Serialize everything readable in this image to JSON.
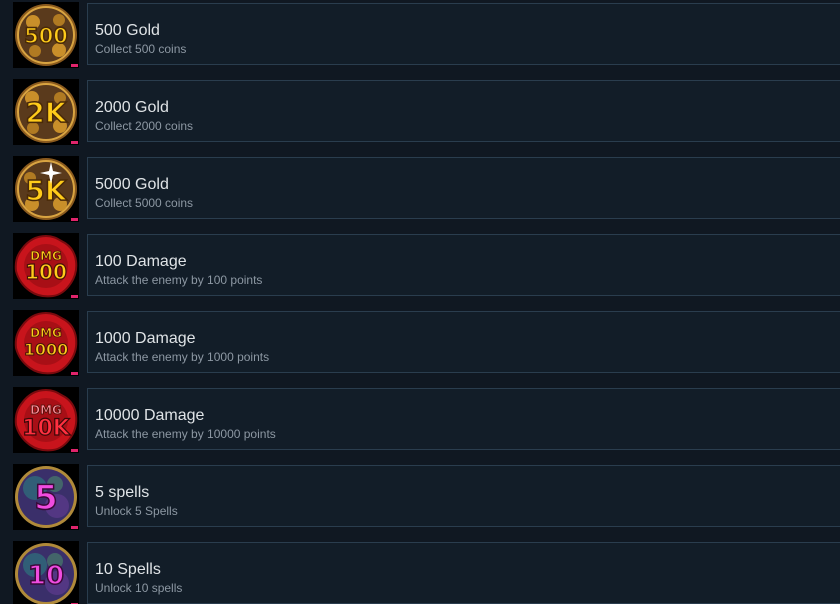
{
  "achievements": [
    {
      "title": "500 Gold",
      "description": "Collect 500 coins",
      "badge_text": "500",
      "badge_sub": "",
      "icon": "gold-coins-icon",
      "theme": "gold"
    },
    {
      "title": "2000 Gold",
      "description": "Collect 2000 coins",
      "badge_text": "2K",
      "badge_sub": "",
      "icon": "gold-coins-icon",
      "theme": "gold"
    },
    {
      "title": "5000 Gold",
      "description": "Collect 5000 coins",
      "badge_text": "5K",
      "badge_sub": "",
      "icon": "gold-coins-sparkle-icon",
      "theme": "gold"
    },
    {
      "title": "100 Damage",
      "description": "Attack the enemy by 100 points",
      "badge_text": "100",
      "badge_sub": "DMG",
      "icon": "damage-seal-icon",
      "theme": "red"
    },
    {
      "title": "1000 Damage",
      "description": "Attack the enemy by 1000 points",
      "badge_text": "1000",
      "badge_sub": "DMG",
      "icon": "damage-seal-icon",
      "theme": "red"
    },
    {
      "title": "10000 Damage",
      "description": "Attack the enemy by 10000 points",
      "badge_text": "10K",
      "badge_sub": "DMG",
      "icon": "damage-seal-icon",
      "theme": "red"
    },
    {
      "title": "5 spells",
      "description": "Unlock 5 Spells",
      "badge_text": "5",
      "badge_sub": "",
      "icon": "spell-orb-icon",
      "theme": "purple"
    },
    {
      "title": "10 Spells",
      "description": "Unlock 10 spells",
      "badge_text": "10",
      "badge_sub": "",
      "icon": "spell-orb-icon",
      "theme": "purple"
    }
  ],
  "colors": {
    "background": "#101822",
    "panel": "#121d28",
    "panel_border": "#2a3d4e",
    "title_text": "#dfe3e6",
    "description_text": "#8d98a3",
    "corner_marker": "#e0246c",
    "gold_text": "#ffcc1a",
    "red_seal": "#c8141c",
    "purple_text": "#f04ce0"
  }
}
